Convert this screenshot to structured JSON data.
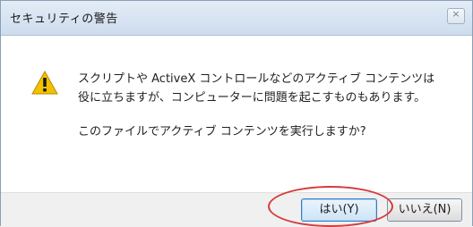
{
  "dialog": {
    "title": "セキュリティの警告",
    "close_label": "×",
    "message_line1": "スクリプトや ActiveX コントロールなどのアクティブ コンテンツは",
    "message_line2": "役に立ちますが、コンピューターに問題を起こすものもあります。",
    "question": "このファイルでアクティブ コンテンツを実行しますか?",
    "buttons": {
      "yes_label": "はい(Y)",
      "no_label": "いいえ(N)"
    }
  },
  "icons": {
    "warning": "warning-icon",
    "close": "close-icon"
  },
  "colors": {
    "highlight": "#d63a3a",
    "warning_fill": "#f2c200"
  }
}
